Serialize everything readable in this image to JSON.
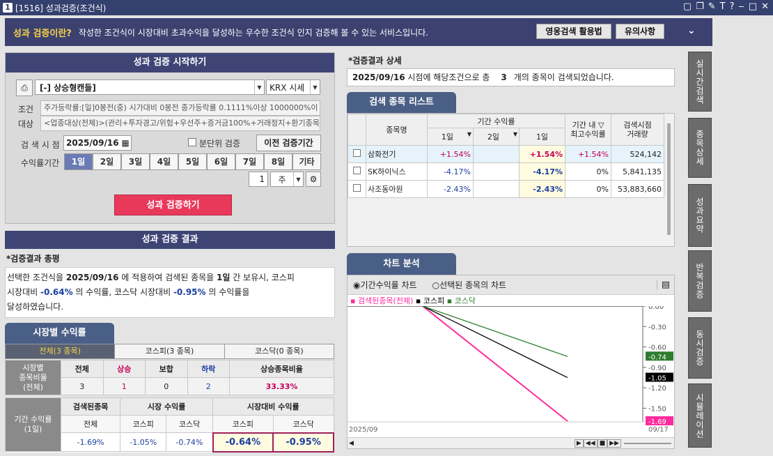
{
  "window": {
    "num": "1",
    "title": "[1516] 성과검증(조건식)"
  },
  "banner": {
    "question": "성과 검증이란?",
    "desc": "작성한 조건식이 시장대비 초과수익을 달성하는 우수한 조건식 인지 검증해 볼 수 있는 서비스입니다.",
    "btn1": "영웅검색 활용법",
    "btn2": "유의사항"
  },
  "start": {
    "header": "성과 검증 시작하기",
    "condition": "[-] 상승형캔들]",
    "market": "KRX 시세",
    "cond_label": "조건",
    "target_label": "대상",
    "cond_text": "주가등락률:[일]0봉전(중) 시가대비 0봉전 종가등락률 0.1111%이상 1000000%이",
    "target_text": "<업종대상(전체)>(관리+투자경고/위험+우선주+증거금100%+거래정지+환기종목",
    "date_label": "검 색 시 점",
    "date": "2025/09/16",
    "minute_label": "분단위 검증",
    "prev_btn": "이전 검증기간",
    "period_label": "수익률기간",
    "periods": [
      "1일",
      "2일",
      "3일",
      "4일",
      "5일",
      "6일",
      "7일",
      "8일",
      "기타"
    ],
    "count": "1",
    "unit": "주",
    "run_btn": "성과 검증하기"
  },
  "result": {
    "header": "성과 검증 결과",
    "summary_title": "*검증결과 총평",
    "s1a": "선택한 조건식을 ",
    "s1b": "2025/09/16",
    "s1c": " 에 적용하여 검색된 종목을 ",
    "s1d": "1일",
    "s1e": " 간 보유시, 코스피",
    "s2a": "시장대비 ",
    "s2b": "-0.64%",
    "s2c": " 의 수익률, 코스닥 시장대비 ",
    "s2d": "-0.95%",
    "s2e": " 의 수익률을",
    "s3": "달성하였습니다."
  },
  "market": {
    "tab": "시장별 수익률",
    "subtabs": [
      "전체(3 종목)",
      "코스피(3 종목)",
      "코스닥(0 종목)"
    ],
    "rowlabel1": "시장별",
    "rowlabel2": "종목비율",
    "rowlabel3": "(전체)",
    "heads": [
      "전체",
      "상승",
      "보합",
      "하락",
      "상승종목비율"
    ],
    "vals": [
      "3",
      "1",
      "0",
      "2",
      "33.33%"
    ],
    "p_label1": "기간 수익률",
    "p_label2": "(1일)",
    "g1": "검색된종목",
    "g2": "시장 수익률",
    "g3": "시장대비 수익률",
    "sub": [
      "전체",
      "코스피",
      "코스닥",
      "코스피",
      "코스닥"
    ],
    "pv": [
      "-1.69%",
      "-1.05%",
      "-0.74%",
      "-0.64%",
      "-0.95%"
    ]
  },
  "detail": {
    "title": "*검증결과 상세",
    "line_date": "2025/09/16",
    "line_a": " 시점에 해당조건으로 총",
    "line_cnt": "3",
    "line_b": "개의 종목이 검색되었습니다."
  },
  "list": {
    "tab": "검색 종목 리스트",
    "h_name": "종목명",
    "h_period": "기간 수익률",
    "h_1d": "1일",
    "h_2d": "2일",
    "h_1d2": "1일",
    "h_max1": "기간 내",
    "h_max2": "최고수익률",
    "h_vol1": "검색시점",
    "h_vol2": "거래량",
    "rows": [
      {
        "name": "삼화전기",
        "r1": "+1.54%",
        "r2": "",
        "r3": "+1.54%",
        "max": "+1.54%",
        "vol": "524,142"
      },
      {
        "name": "SK하이닉스",
        "r1": "-4.17%",
        "r2": "",
        "r3": "-4.17%",
        "max": "0%",
        "vol": "5,841,135"
      },
      {
        "name": "사조동아원",
        "r1": "-2.43%",
        "r2": "",
        "r3": "-2.43%",
        "max": "0%",
        "vol": "53,883,660"
      }
    ]
  },
  "chart": {
    "tab": "차트 분석",
    "opt1": "기간수익률 차트",
    "opt2": "선택된 종목의 차트",
    "leg1": "검색된종목(전체)",
    "leg2": "코스피",
    "leg3": "코스닥",
    "yticks": [
      "0.00",
      "-0.30",
      "-0.60",
      "-0.90",
      "-1.20",
      "-1.50"
    ],
    "lab_kosdaq": "-0.74",
    "lab_kospi": "-1.05",
    "lab_total": "-1.69",
    "x_start": "2025/09",
    "x_end": "09/17",
    "colors": {
      "total": "#ff2a9d",
      "kospi": "#000000",
      "kosdaq": "#2e7d2e"
    }
  },
  "chart_data": {
    "type": "line",
    "x": [
      "2025/09/16",
      "2025/09/17"
    ],
    "series": [
      {
        "name": "검색된종목(전체)",
        "values": [
          0,
          -1.69
        ]
      },
      {
        "name": "코스피",
        "values": [
          0,
          -1.05
        ]
      },
      {
        "name": "코스닥",
        "values": [
          0,
          -0.74
        ]
      }
    ],
    "ylim": [
      -1.69,
      0
    ]
  },
  "vtabs": [
    "실시간검색",
    "종목상세",
    "성과요약",
    "반복검증",
    "동시검증",
    "시뮬레이션"
  ]
}
